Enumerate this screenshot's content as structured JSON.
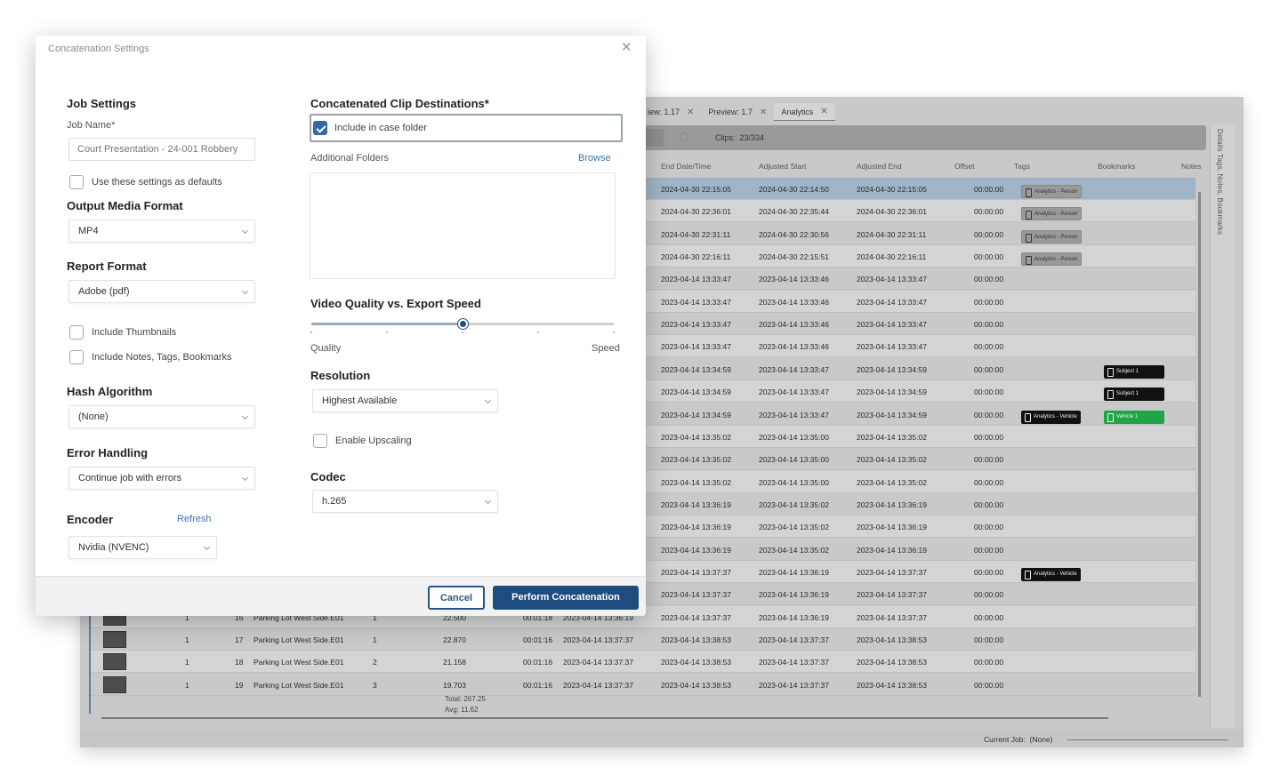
{
  "app": {
    "tabs": [
      {
        "label": "iew: 1.17",
        "active": false
      },
      {
        "label": "Preview: 1.7",
        "active": false
      },
      {
        "label": "Analytics",
        "active": true
      }
    ],
    "filter_stub": "if",
    "clips_label": "Clips:",
    "clips_value": "23/334",
    "right_panel_label": "Details   Tags, Notes, Bookmarks",
    "columns": [
      "End Date/Time",
      "Adjusted Start",
      "Adjusted End",
      "Offset",
      "Tags",
      "Bookmarks",
      "Notes"
    ],
    "rows": [
      {
        "end": "2024-04-30 22:15:05",
        "adj_start": "2024-04-30 22:14:50",
        "adj_end": "2024-04-30 22:15:05",
        "offset": "00:00:00",
        "tag": "Analytics - Person",
        "tag_style": "grey",
        "bookmark": ""
      },
      {
        "end": "2024-04-30 22:36:01",
        "adj_start": "2024-04-30 22:35:44",
        "adj_end": "2024-04-30 22:36:01",
        "offset": "00:00:00",
        "tag": "Analytics - Person",
        "tag_style": "grey",
        "bookmark": ""
      },
      {
        "end": "2024-04-30 22:31:11",
        "adj_start": "2024-04-30 22:30:56",
        "adj_end": "2024-04-30 22:31:11",
        "offset": "00:00:00",
        "tag": "Analytics - Person",
        "tag_style": "grey",
        "bookmark": ""
      },
      {
        "end": "2024-04-30 22:16:11",
        "adj_start": "2024-04-30 22:15:51",
        "adj_end": "2024-04-30 22:16:11",
        "offset": "00:00:00",
        "tag": "Analytics - Person",
        "tag_style": "grey",
        "bookmark": ""
      },
      {
        "end": "2023-04-14 13:33:47",
        "adj_start": "2023-04-14 13:33:46",
        "adj_end": "2023-04-14 13:33:47",
        "offset": "00:00:00",
        "tag": "",
        "tag_style": "",
        "bookmark": ""
      },
      {
        "end": "2023-04-14 13:33:47",
        "adj_start": "2023-04-14 13:33:46",
        "adj_end": "2023-04-14 13:33:47",
        "offset": "00:00:00",
        "tag": "",
        "tag_style": "",
        "bookmark": ""
      },
      {
        "end": "2023-04-14 13:33:47",
        "adj_start": "2023-04-14 13:33:46",
        "adj_end": "2023-04-14 13:33:47",
        "offset": "00:00:00",
        "tag": "",
        "tag_style": "",
        "bookmark": ""
      },
      {
        "end": "2023-04-14 13:33:47",
        "adj_start": "2023-04-14 13:33:46",
        "adj_end": "2023-04-14 13:33:47",
        "offset": "00:00:00",
        "tag": "",
        "tag_style": "",
        "bookmark": ""
      },
      {
        "end": "2023-04-14 13:34:59",
        "adj_start": "2023-04-14 13:33:47",
        "adj_end": "2023-04-14 13:34:59",
        "offset": "00:00:00",
        "tag": "",
        "tag_style": "",
        "bookmark": "Subject 1",
        "bookmark_style": "black"
      },
      {
        "end": "2023-04-14 13:34:59",
        "adj_start": "2023-04-14 13:33:47",
        "adj_end": "2023-04-14 13:34:59",
        "offset": "00:00:00",
        "tag": "",
        "tag_style": "",
        "bookmark": "Subject 1",
        "bookmark_style": "black"
      },
      {
        "end": "2023-04-14 13:34:59",
        "adj_start": "2023-04-14 13:33:47",
        "adj_end": "2023-04-14 13:34:59",
        "offset": "00:00:00",
        "tag": "Analytics - Vehicle",
        "tag_style": "black",
        "bookmark": "Vehicle 1",
        "bookmark_style": "green"
      },
      {
        "end": "2023-04-14 13:35:02",
        "adj_start": "2023-04-14 13:35:00",
        "adj_end": "2023-04-14 13:35:02",
        "offset": "00:00:00",
        "tag": "",
        "tag_style": "",
        "bookmark": ""
      },
      {
        "end": "2023-04-14 13:35:02",
        "adj_start": "2023-04-14 13:35:00",
        "adj_end": "2023-04-14 13:35:02",
        "offset": "00:00:00",
        "tag": "",
        "tag_style": "",
        "bookmark": ""
      },
      {
        "end": "2023-04-14 13:35:02",
        "adj_start": "2023-04-14 13:35:00",
        "adj_end": "2023-04-14 13:35:02",
        "offset": "00:00:00",
        "tag": "",
        "tag_style": "",
        "bookmark": ""
      },
      {
        "end": "2023-04-14 13:36:19",
        "adj_start": "2023-04-14 13:35:02",
        "adj_end": "2023-04-14 13:36:19",
        "offset": "00:00:00",
        "tag": "",
        "tag_style": "",
        "bookmark": ""
      },
      {
        "end": "2023-04-14 13:36:19",
        "adj_start": "2023-04-14 13:35:02",
        "adj_end": "2023-04-14 13:36:19",
        "offset": "00:00:00",
        "tag": "",
        "tag_style": "",
        "bookmark": ""
      },
      {
        "end": "2023-04-14 13:36:19",
        "adj_start": "2023-04-14 13:35:02",
        "adj_end": "2023-04-14 13:36:19",
        "offset": "00:00:00",
        "tag": "",
        "tag_style": "",
        "bookmark": ""
      },
      {
        "end": "2023-04-14 13:37:37",
        "adj_start": "2023-04-14 13:36:19",
        "adj_end": "2023-04-14 13:37:37",
        "offset": "00:00:00",
        "tag": "Analytics - Vehicle",
        "tag_style": "black",
        "bookmark": ""
      },
      {
        "end": "2023-04-14 13:37:37",
        "adj_start": "2023-04-14 13:36:19",
        "adj_end": "2023-04-14 13:37:37",
        "offset": "00:00:00",
        "tag": "",
        "tag_style": "",
        "bookmark": ""
      },
      {
        "end": "2023-04-14 13:37:37",
        "adj_start": "2023-04-14 13:36:19",
        "adj_end": "2023-04-14 13:37:37",
        "offset": "00:00:00",
        "tag": "",
        "tag_style": "",
        "bookmark": "",
        "left": {
          "cam": "1",
          "idx": "16",
          "name": "Parking Lot West Side.E01",
          "n": "1",
          "size": "22.500",
          "dur": "00:01:18",
          "start": "2023-04-14 13:36:19"
        }
      },
      {
        "end": "2023-04-14 13:38:53",
        "adj_start": "2023-04-14 13:37:37",
        "adj_end": "2023-04-14 13:38:53",
        "offset": "00:00:00",
        "tag": "",
        "tag_style": "",
        "bookmark": "",
        "left": {
          "cam": "1",
          "idx": "17",
          "name": "Parking Lot West Side.E01",
          "n": "1",
          "size": "22.870",
          "dur": "00:01:16",
          "start": "2023-04-14 13:37:37"
        }
      },
      {
        "end": "2023-04-14 13:38:53",
        "adj_start": "2023-04-14 13:37:37",
        "adj_end": "2023-04-14 13:38:53",
        "offset": "00:00:00",
        "tag": "",
        "tag_style": "",
        "bookmark": "",
        "left": {
          "cam": "1",
          "idx": "18",
          "name": "Parking Lot West Side.E01",
          "n": "2",
          "size": "21.158",
          "dur": "00:01:16",
          "start": "2023-04-14 13:37:37"
        }
      },
      {
        "end": "2023-04-14 13:38:53",
        "adj_start": "2023-04-14 13:37:37",
        "adj_end": "2023-04-14 13:38:53",
        "offset": "00:00:00",
        "tag": "",
        "tag_style": "",
        "bookmark": "",
        "left": {
          "cam": "1",
          "idx": "19",
          "name": "Parking Lot West Side.E01",
          "n": "3",
          "size": "19.703",
          "dur": "00:01:16",
          "start": "2023-04-14 13:37:37"
        }
      }
    ],
    "totals": {
      "total": "Total: 267.25",
      "avg": "Avg: 11.62"
    },
    "current_job_label": "Current Job:",
    "current_job_value": "(None)"
  },
  "dialog": {
    "title": "Concatenation Settings",
    "job_settings": {
      "heading": "Job Settings",
      "job_name_label": "Job Name*",
      "job_name_value": "Court Presentation - 24-001 Robbery",
      "use_defaults_label": "Use these settings as defaults",
      "use_defaults_checked": false
    },
    "output_media_format": {
      "heading": "Output Media Format",
      "value": "MP4"
    },
    "report_format": {
      "heading": "Report Format",
      "value": "Adobe (pdf)",
      "include_thumbnails_label": "Include Thumbnails",
      "include_thumbnails_checked": false,
      "include_notes_label": "Include Notes, Tags, Bookmarks",
      "include_notes_checked": false
    },
    "hash_algorithm": {
      "heading": "Hash Algorithm",
      "value": "(None)"
    },
    "error_handling": {
      "heading": "Error Handling",
      "value": "Continue job with errors"
    },
    "encoder": {
      "heading": "Encoder",
      "refresh_label": "Refresh",
      "value": "Nvidia (NVENC)"
    },
    "destinations": {
      "heading": "Concatenated Clip Destinations*",
      "include_case_folder_label": "Include in case folder",
      "include_case_folder_checked": true,
      "additional_folders_label": "Additional Folders",
      "browse_label": "Browse"
    },
    "quality_speed": {
      "heading": "Video Quality vs. Export Speed",
      "min_label": "Quality",
      "max_label": "Speed",
      "value_fraction": 0.5,
      "ticks": 5
    },
    "resolution": {
      "heading": "Resolution",
      "value": "Highest Available",
      "upscaling_label": "Enable Upscaling",
      "upscaling_checked": false
    },
    "codec": {
      "heading": "Codec",
      "value": "h.265"
    },
    "buttons": {
      "cancel": "Cancel",
      "perform": "Perform Concatenation"
    }
  }
}
